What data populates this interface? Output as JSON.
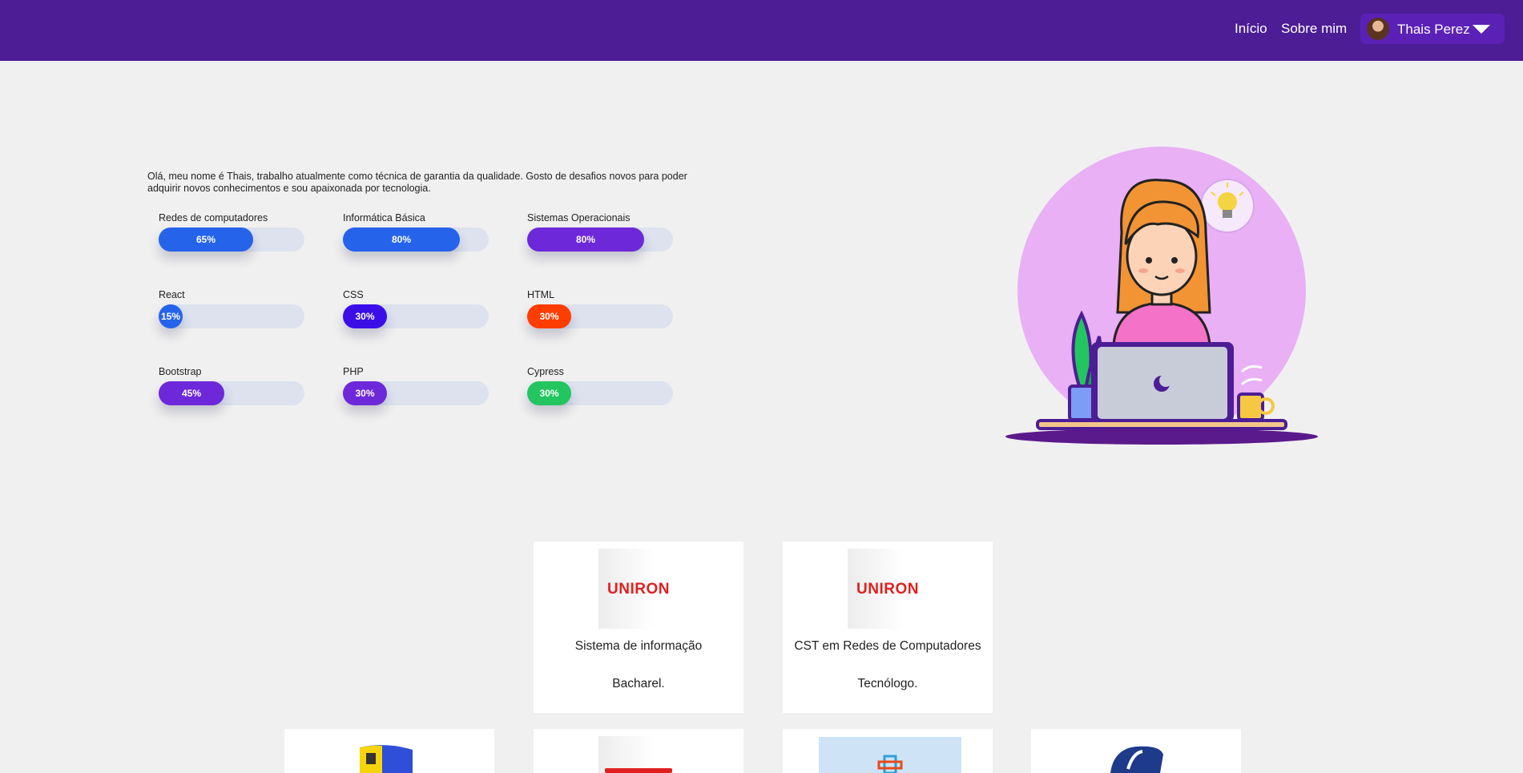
{
  "nav": {
    "links": [
      "Início",
      "Sobre mim"
    ],
    "user": "Thais Perez"
  },
  "intro": "Olá, meu nome é Thais, trabalho atualmente como técnica de garantia da qualidade. Gosto de desafios novos para poder adquirir novos conhecimentos e sou apaixonada por tecnologia.",
  "skills": [
    {
      "name": "Redes de computadores",
      "pct": "65%",
      "value": 65,
      "color": "#2563eb"
    },
    {
      "name": "Informática Básica",
      "pct": "80%",
      "value": 80,
      "color": "#2563eb"
    },
    {
      "name": "Sistemas Operacionais",
      "pct": "80%",
      "value": 80,
      "color": "#6d28d9"
    },
    {
      "name": "React",
      "pct": "15%",
      "value": 15,
      "color": "#2563eb"
    },
    {
      "name": "CSS",
      "pct": "30%",
      "value": 30,
      "color": "#3b0ee8"
    },
    {
      "name": "HTML",
      "pct": "30%",
      "value": 30,
      "color": "#ff3d00"
    },
    {
      "name": "Bootstrap",
      "pct": "45%",
      "value": 45,
      "color": "#6d28d9"
    },
    {
      "name": "PHP",
      "pct": "30%",
      "value": 30,
      "color": "#6d28d9"
    },
    {
      "name": "Cypress",
      "pct": "30%",
      "value": 30,
      "color": "#22c55e"
    }
  ],
  "education": [
    {
      "logo": "UNIRON",
      "title": "Sistema de informação",
      "degree": "Bacharel."
    },
    {
      "logo": "UNIRON",
      "title": "CST em Redes de Computadores",
      "degree": "Tecnólogo."
    }
  ],
  "colors": {
    "navbar": "#4c1d95",
    "background": "#f0f0f0",
    "illustration_circle": "#e9b0f5"
  },
  "icons": [
    "avatar",
    "caret-down-icon",
    "lightbulb-icon",
    "moon-icon",
    "plant-icon",
    "coffee-mug-icon"
  ]
}
